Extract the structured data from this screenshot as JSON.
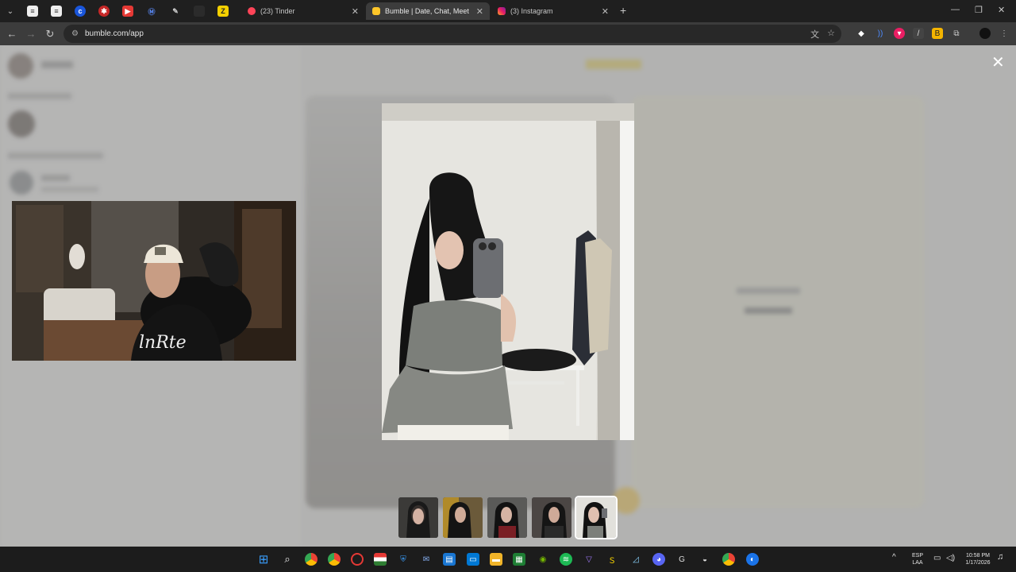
{
  "browser": {
    "tabs": [
      {
        "title": "(23) Tinder",
        "active": false
      },
      {
        "title": "Bumble | Date, Chat, Meet New",
        "active": true
      },
      {
        "title": "(3) Instagram",
        "active": false
      }
    ],
    "url": "bumble.com/app"
  },
  "page": {
    "close_symbol": "✕"
  },
  "taskbar": {
    "language": "ESP",
    "language_sub": "LAA",
    "time": "10:58 PM",
    "date": "1/17/2026"
  },
  "colors": {
    "bumble_yellow": "#ffc629",
    "chrome_dark": "#1f1f1f",
    "toolbar": "#3c3c3c"
  }
}
